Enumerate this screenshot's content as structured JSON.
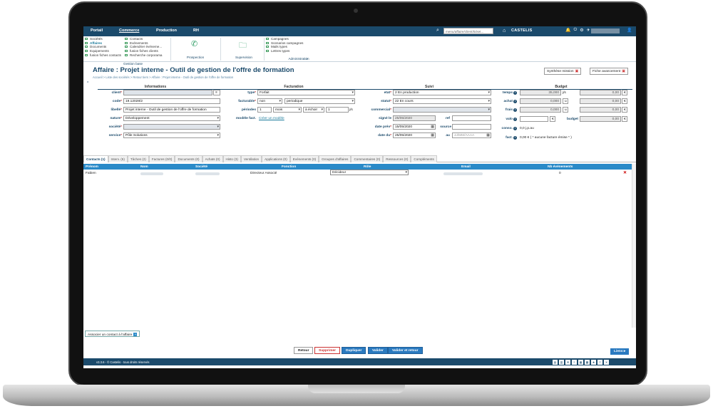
{
  "topbar": {
    "tabs": [
      "Portail",
      "Commerce",
      "Production",
      "RH"
    ],
    "active_tab": "Commerce",
    "search_placeholder": "menu/affaire/client/ticket...",
    "brand": "CASTELIS",
    "icons": [
      "bell-icon",
      "power-icon",
      "gear-icon",
      "plane-icon",
      "user-icon"
    ]
  },
  "menu": {
    "col1": [
      "Sociétés",
      "Affaires",
      "Documents",
      "Equipements",
      "fusion fiches contacts"
    ],
    "col2": [
      "Contacts",
      "Evénements",
      "Calendrier événeme...",
      "fusion fiches clients",
      "Recherche corporama"
    ],
    "gestion_base_label": "Gestion base",
    "prospection_label": "Prospection",
    "supervision_label": "Supervision",
    "col3": [
      "Campagnes",
      "Scenarios campagnes",
      "Mails types",
      "Lettres types"
    ],
    "administration_label": "Administration"
  },
  "page": {
    "title": "Affaire : Projet interne - Outil de gestion de l'offre de formation",
    "breadcrumb": "Accueil > Liste des sociétés > Retour tiers > Affaire : Projet interne - Outil de gestion de l'offre de formation",
    "synthese_label": "Synthèse mission",
    "fiche_label": "Fiche avancement"
  },
  "informations": {
    "title": "Informations",
    "client_label": "client",
    "code_label": "code",
    "code_value": "19.12028/2",
    "libelle_label": "libellé",
    "libelle_value": "Projet interne - Outil de gestion de l'offre de formation",
    "nature_label": "nature",
    "nature_value": "Développement",
    "societe_label": "société",
    "service_label": "service",
    "service_value": "Pôle Solutions"
  },
  "facturation": {
    "title": "Facturation",
    "type_label": "type",
    "type_value": "Forfait",
    "facturable_label": "facturable",
    "facturable_value": "non",
    "facturable_period": "periodique",
    "periodes_label": "périodes",
    "periodes_n": "1",
    "periodes_unit": "mois",
    "periodes_mode": "à échoir",
    "periodes_jours": "1",
    "jours_unit": "j/s",
    "modele_label": "modèle fact.",
    "modele_link": "Créer un modèle"
  },
  "suivi": {
    "title": "Suivi",
    "etat_label": "etat",
    "etat_value": "2 En production",
    "statut_label": "statut",
    "statut_value": "22 En cours",
    "commercial_label": "commercial",
    "signe_label": "signé le",
    "signe_value": "25/05/2020",
    "ref_label": "ref",
    "date_prev_label": "date prév",
    "date_prev_value": "15/05/2020",
    "source_label": "source",
    "date_du_label": "date du",
    "date_du_value": "25/05/2020",
    "au_label": "au",
    "au_placeholder": "JJ/MM/AAAA"
  },
  "budget": {
    "title": "Budget",
    "temps_label": "temps",
    "temps_value": "35,000",
    "temps_unit": "j/s",
    "temps_right": "0,00",
    "achat_label": "achat",
    "achat_value": "0,000",
    "achat_unit": "u",
    "achat_right": "0,00",
    "frais_label": "frais",
    "frais_value": "0,000",
    "frais_unit": "u",
    "frais_right": "0,00",
    "valo_label": "valo",
    "valo_unit": "€",
    "budget_label": "budget",
    "budget_right": "0,00",
    "currency": "€",
    "conso_label": "conso.",
    "conso_value": "0,0 j.p.au",
    "fact_label": "fact.",
    "fact_value": "0,00 € ( * aucune facture émise * )"
  },
  "tabs": [
    "Contacts (1)",
    "Interv. (5)",
    "Tâches (2)",
    "Factures (0/0)",
    "Documents (0)",
    "Achats (0)",
    "Histo (3)",
    "Ventilation",
    "Applications (0)",
    "Evénements (0)",
    "Groupes d'affaires",
    "Commentaires (0)",
    "Ressources (0)",
    "Compléments"
  ],
  "table": {
    "headers": [
      "Prénom",
      "Nom",
      "Société",
      "Fonction",
      "Rôle",
      "Email",
      "Nb événements"
    ],
    "row": {
      "prenom": "Fabien",
      "fonction": "Directeur Associé",
      "role": "Décideur",
      "nb": "0"
    }
  },
  "assoc_label": "Associer un contact à l'affaire",
  "buttons": {
    "retour": "Retour",
    "supprimer": "Supprimer",
    "dupliquer": "Dupliquer",
    "valider": "Valider",
    "valider_retour": "Valider et retour",
    "liens": "Liens"
  },
  "footer": {
    "version": "v3.3.6 - © Castelis - tous droits réservés"
  }
}
